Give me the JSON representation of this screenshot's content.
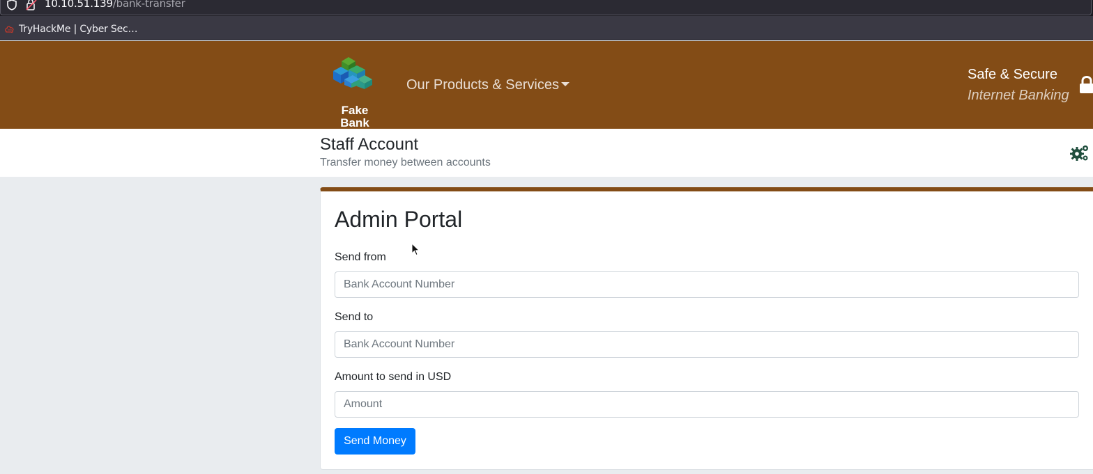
{
  "browser": {
    "url_host": "10.10.51.139",
    "url_path": "/bank-transfer",
    "bookmark": "TryHackMe | Cyber Sec…"
  },
  "header": {
    "logo_line1": "Fake",
    "logo_line2": "Bank",
    "nav_products": "Our Products & Services",
    "tagline_line1": "Safe & Secure",
    "tagline_line2": "Internet Banking"
  },
  "subheader": {
    "title": "Staff Account",
    "subtitle": "Transfer money between accounts"
  },
  "card": {
    "title": "Admin Portal",
    "fields": [
      {
        "label": "Send from",
        "placeholder": "Bank Account Number",
        "value": ""
      },
      {
        "label": "Send to",
        "placeholder": "Bank Account Number",
        "value": ""
      },
      {
        "label": "Amount to send in USD",
        "placeholder": "Amount",
        "value": ""
      }
    ],
    "submit_label": "Send Money"
  },
  "icons": {
    "url_security": "shield-icon",
    "url_lock": "insecure-lock-icon",
    "bookmark_favicon": "tryhackme-favicon-icon",
    "header_lock": "lock-icon",
    "settings": "gears-icon"
  },
  "colors": {
    "brand_brown": "#834c16",
    "primary_button": "#007bff",
    "page_background": "#e9ecef"
  }
}
